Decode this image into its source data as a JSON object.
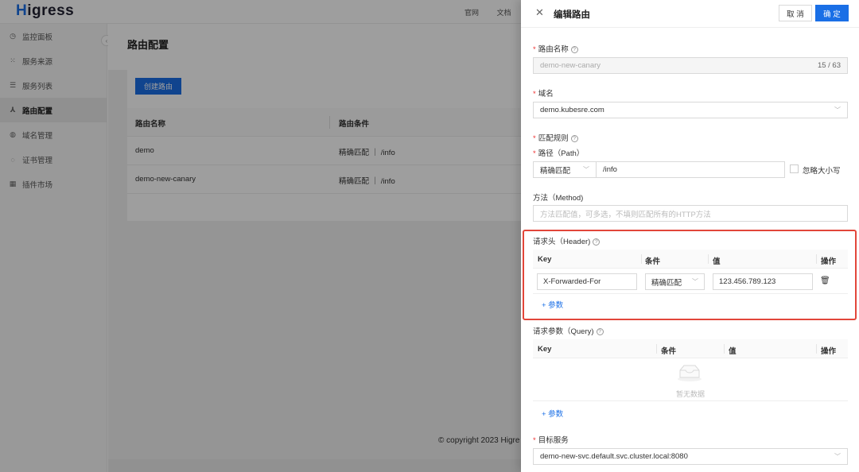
{
  "topbar": {
    "logo_h": "H",
    "logo_rest": "igress",
    "links": [
      "官网",
      "文档"
    ]
  },
  "sidebar": {
    "items": [
      {
        "label": "监控面板",
        "icon": "dashboard-icon",
        "glyph": "◷"
      },
      {
        "label": "服务来源",
        "icon": "source-icon",
        "glyph": "⁙"
      },
      {
        "label": "服务列表",
        "icon": "list-icon",
        "glyph": "☰"
      },
      {
        "label": "路由配置",
        "icon": "route-icon",
        "glyph": "⅄"
      },
      {
        "label": "域名管理",
        "icon": "globe-icon",
        "glyph": "◍"
      },
      {
        "label": "证书管理",
        "icon": "shield-icon",
        "glyph": "◌"
      },
      {
        "label": "插件市场",
        "icon": "plugin-icon",
        "glyph": "▦"
      }
    ],
    "collapse_glyph": "‹"
  },
  "page": {
    "title": "路由配置",
    "create_button": "创建路由",
    "table": {
      "headers": [
        "路由名称",
        "路由条件"
      ],
      "rows": [
        {
          "name": "demo",
          "condition": "精确匹配 ｜ /info"
        },
        {
          "name": "demo-new-canary",
          "condition": "精确匹配 ｜ /info"
        }
      ]
    },
    "footer": "© copyright 2023 Higre"
  },
  "drawer": {
    "title": "编辑路由",
    "close_glyph": "✕",
    "cancel": "取 消",
    "ok": "确 定",
    "route_name": {
      "label": "路由名称",
      "value": "demo-new-canary",
      "count": "15 / 63"
    },
    "domain": {
      "label": "域名",
      "value": "demo.kubesre.com"
    },
    "match_rules": {
      "label": "匹配规则"
    },
    "path": {
      "label": "路径（Path）",
      "match_type": "精确匹配",
      "value": "/info",
      "ignore_case": "忽略大小写"
    },
    "method": {
      "label": "方法（Method)",
      "placeholder": "方法匹配值，可多选，不填则匹配所有的HTTP方法"
    },
    "header": {
      "label": "请求头（Header)",
      "columns": [
        "Key",
        "条件",
        "值",
        "操作"
      ],
      "rows": [
        {
          "key": "X-Forwarded-For",
          "cond": "精确匹配",
          "value": "123.456.789.123"
        }
      ],
      "add": "+  参数"
    },
    "query": {
      "label": "请求参数（Query)",
      "columns": [
        "Key",
        "条件",
        "值",
        "操作"
      ],
      "empty": "暂无数据",
      "add": "+  参数"
    },
    "target": {
      "label": "目标服务",
      "value": "demo-new-svc.default.svc.cluster.local:8080"
    },
    "help_glyph": "?",
    "chev_glyph": "﹀",
    "trash_glyph": "🗑"
  },
  "colors": {
    "primary": "#1a6fe6",
    "highlight": "#e2463a",
    "required": "#e33"
  }
}
